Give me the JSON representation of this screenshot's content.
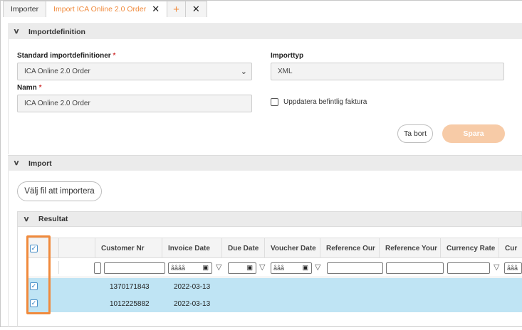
{
  "tabs": [
    {
      "label": "Importer",
      "active": false
    },
    {
      "label": "Import ICA Online 2.0 Order",
      "active": true,
      "close": "✕"
    },
    {
      "label": "+",
      "kind": "add"
    },
    {
      "label": "✕",
      "kind": "close-all"
    }
  ],
  "importdefinition": {
    "header": "Importdefinition",
    "standard_label": "Standard importdefinitioner",
    "standard_value": "ICA Online 2.0 Order",
    "importtyp_label": "Importtyp",
    "importtyp_value": "XML",
    "namn_label": "Namn",
    "namn_value": "ICA Online 2.0 Order",
    "update_checkbox_label": "Uppdatera befintlig faktura",
    "delete_button": "Ta bort",
    "save_button": "Spara",
    "required_mark": "*"
  },
  "import": {
    "header": "Import",
    "choose_file_button": "Välj fil att importera"
  },
  "resultat": {
    "header": "Resultat",
    "columns": [
      "Customer Nr",
      "Invoice Date",
      "Due Date",
      "Voucher Date",
      "Reference Our",
      "Reference Your",
      "Currency Rate",
      "Cur"
    ],
    "date_placeholder": "åååå",
    "date_placeholder_short": "ååå",
    "rows": [
      {
        "customer_nr": "1370171843",
        "invoice_date": "2022-03-13"
      },
      {
        "customer_nr": "1012225882",
        "invoice_date": "2022-03-13"
      }
    ]
  },
  "colors": {
    "accent": "#f08a3c",
    "selected_row": "#bfe4f4",
    "save_button_bg": "#f7cba7",
    "required": "#d23c3c"
  }
}
